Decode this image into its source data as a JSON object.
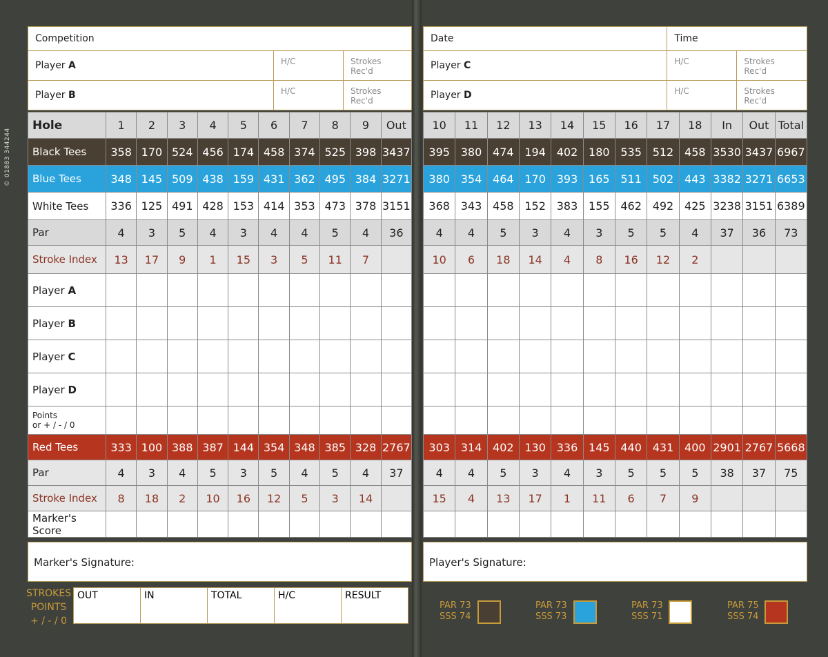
{
  "side_code": "© 01883 344244",
  "left_header": {
    "competition_label": "Competition",
    "player_a_prefix": "Player ",
    "player_a_letter": "A",
    "player_b_prefix": "Player ",
    "player_b_letter": "B",
    "hc_label": "H/C",
    "strokes_label": "Strokes Rec'd"
  },
  "right_header": {
    "date_label": "Date",
    "time_label": "Time",
    "player_c_prefix": "Player ",
    "player_c_letter": "C",
    "player_d_prefix": "Player ",
    "player_d_letter": "D",
    "hc_label": "H/C",
    "strokes_label": "Strokes Rec'd"
  },
  "row_labels": {
    "hole": "Hole",
    "black": "Black Tees",
    "blue": "Blue Tees",
    "white": "White Tees",
    "par": "Par",
    "stroke_index": "Stroke Index",
    "player_prefix": "Player ",
    "player_a": "A",
    "player_b": "B",
    "player_c": "C",
    "player_d": "D",
    "points_line1": "Points",
    "points_line2": "or + / - / 0",
    "red": "Red Tees",
    "markers_score": "Marker's Score"
  },
  "front": {
    "holes": [
      "1",
      "2",
      "3",
      "4",
      "5",
      "6",
      "7",
      "8",
      "9",
      "Out"
    ],
    "black": [
      "358",
      "170",
      "524",
      "456",
      "174",
      "458",
      "374",
      "525",
      "398",
      "3437"
    ],
    "blue": [
      "348",
      "145",
      "509",
      "438",
      "159",
      "431",
      "362",
      "495",
      "384",
      "3271"
    ],
    "white": [
      "336",
      "125",
      "491",
      "428",
      "153",
      "414",
      "353",
      "473",
      "378",
      "3151"
    ],
    "par": [
      "4",
      "3",
      "5",
      "4",
      "3",
      "4",
      "4",
      "5",
      "4",
      "36"
    ],
    "stroke_index": [
      "13",
      "17",
      "9",
      "1",
      "15",
      "3",
      "5",
      "11",
      "7",
      ""
    ],
    "red": [
      "333",
      "100",
      "388",
      "387",
      "144",
      "354",
      "348",
      "385",
      "328",
      "2767"
    ],
    "red_par": [
      "4",
      "3",
      "4",
      "5",
      "3",
      "5",
      "4",
      "5",
      "4",
      "37"
    ],
    "red_stroke_index": [
      "8",
      "18",
      "2",
      "10",
      "16",
      "12",
      "5",
      "3",
      "14",
      ""
    ]
  },
  "back": {
    "holes": [
      "10",
      "11",
      "12",
      "13",
      "14",
      "15",
      "16",
      "17",
      "18",
      "In",
      "Out",
      "Total"
    ],
    "black": [
      "395",
      "380",
      "474",
      "194",
      "402",
      "180",
      "535",
      "512",
      "458",
      "3530",
      "3437",
      "6967"
    ],
    "blue": [
      "380",
      "354",
      "464",
      "170",
      "393",
      "165",
      "511",
      "502",
      "443",
      "3382",
      "3271",
      "6653"
    ],
    "white": [
      "368",
      "343",
      "458",
      "152",
      "383",
      "155",
      "462",
      "492",
      "425",
      "3238",
      "3151",
      "6389"
    ],
    "par": [
      "4",
      "4",
      "5",
      "3",
      "4",
      "3",
      "5",
      "5",
      "4",
      "37",
      "36",
      "73"
    ],
    "stroke_index": [
      "10",
      "6",
      "18",
      "14",
      "4",
      "8",
      "16",
      "12",
      "2",
      "",
      "",
      ""
    ],
    "red": [
      "303",
      "314",
      "402",
      "130",
      "336",
      "145",
      "440",
      "431",
      "400",
      "2901",
      "2767",
      "5668"
    ],
    "red_par": [
      "4",
      "4",
      "5",
      "3",
      "4",
      "3",
      "5",
      "5",
      "5",
      "38",
      "37",
      "75"
    ],
    "red_stroke_index": [
      "15",
      "4",
      "13",
      "17",
      "1",
      "11",
      "6",
      "7",
      "9",
      "",
      "",
      ""
    ]
  },
  "signatures": {
    "marker": "Marker's Signature:",
    "player": "Player's Signature:"
  },
  "strokes_points": {
    "line1": "STROKES",
    "line2": "POINTS",
    "line3": "+ / - / 0",
    "boxes": [
      "OUT",
      "IN",
      "TOTAL",
      "H/C",
      "RESULT"
    ]
  },
  "legend": [
    {
      "par": "PAR 73",
      "sss": "SSS 74",
      "color": "#4a3f33"
    },
    {
      "par": "PAR 73",
      "sss": "SSS 73",
      "color": "#2aa3dc"
    },
    {
      "par": "PAR 73",
      "sss": "SSS 71",
      "color": "#ffffff"
    },
    {
      "par": "PAR 75",
      "sss": "SSS 74",
      "color": "#b5351f"
    }
  ]
}
